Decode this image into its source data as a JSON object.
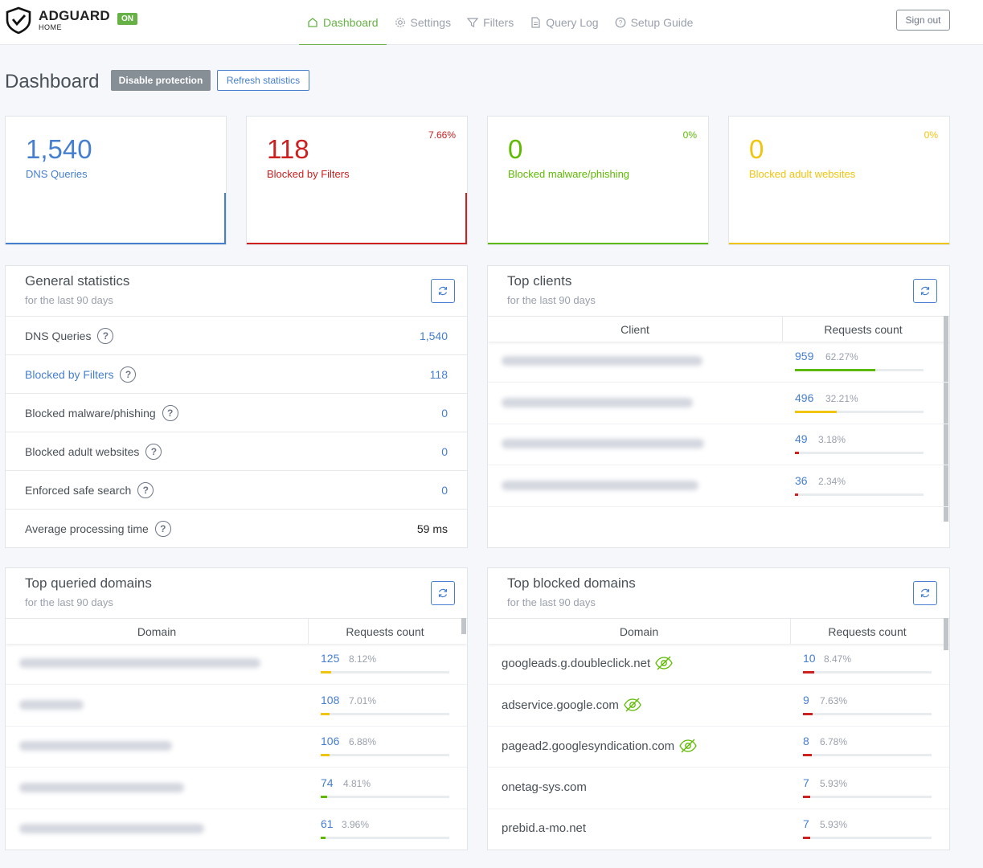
{
  "header": {
    "logo_title": "ADGUARD",
    "logo_sub": "HOME",
    "status_badge": "ON",
    "nav": [
      "Dashboard",
      "Settings",
      "Filters",
      "Query Log",
      "Setup Guide"
    ],
    "active_nav": "Dashboard",
    "signout": "Sign out"
  },
  "toolbar": {
    "title": "Dashboard",
    "disable": "Disable protection",
    "refresh": "Refresh statistics"
  },
  "stats": [
    {
      "value": "1,540",
      "label": "DNS Queries",
      "pct": "",
      "color": "#467fcf"
    },
    {
      "value": "118",
      "label": "Blocked by Filters",
      "pct": "7.66%",
      "color": "#cd201f"
    },
    {
      "value": "0",
      "label": "Blocked malware/phishing",
      "pct": "0%",
      "color": "#5eba00"
    },
    {
      "value": "0",
      "label": "Blocked adult websites",
      "pct": "0%",
      "color": "#f1c40f"
    }
  ],
  "general": {
    "title": "General statistics",
    "sub": "for the last 90 days",
    "rows": [
      {
        "label": "DNS Queries",
        "value": "1,540"
      },
      {
        "label": "Blocked by Filters",
        "value": "118"
      },
      {
        "label": "Blocked malware/phishing",
        "value": "0"
      },
      {
        "label": "Blocked adult websites",
        "value": "0"
      },
      {
        "label": "Enforced safe search",
        "value": "0"
      },
      {
        "label": "Average processing time",
        "value": "59 ms"
      }
    ]
  },
  "clients": {
    "title": "Top clients",
    "sub": "for the last 90 days",
    "col_a": "Client",
    "col_b": "Requests count",
    "rows": [
      {
        "count": "959",
        "pct": "62.27%",
        "fill": 0.6227,
        "color": "#5eba00"
      },
      {
        "count": "496",
        "pct": "32.21%",
        "fill": 0.3221,
        "color": "#f1c40f"
      },
      {
        "count": "49",
        "pct": "3.18%",
        "fill": 0.0318,
        "color": "#cd201f"
      },
      {
        "count": "36",
        "pct": "2.34%",
        "fill": 0.0234,
        "color": "#cd201f"
      }
    ]
  },
  "queried": {
    "title": "Top queried domains",
    "sub": "for the last 90 days",
    "col_a": "Domain",
    "col_b": "Requests count",
    "rows": [
      {
        "count": "125",
        "pct": "8.12%",
        "fill": 0.0812,
        "color": "#f1c40f"
      },
      {
        "count": "108",
        "pct": "7.01%",
        "fill": 0.0701,
        "color": "#f1c40f"
      },
      {
        "count": "106",
        "pct": "6.88%",
        "fill": 0.0688,
        "color": "#f1c40f"
      },
      {
        "count": "74",
        "pct": "4.81%",
        "fill": 0.0481,
        "color": "#5eba00"
      },
      {
        "count": "61",
        "pct": "3.96%",
        "fill": 0.0396,
        "color": "#5eba00"
      }
    ]
  },
  "blocked": {
    "title": "Top blocked domains",
    "sub": "for the last 90 days",
    "col_a": "Domain",
    "col_b": "Requests count",
    "rows": [
      {
        "domain": "googleads.g.doubleclick.net",
        "count": "10",
        "pct": "8.47%",
        "fill": 0.0847,
        "color": "#cd201f",
        "eye": true
      },
      {
        "domain": "adservice.google.com",
        "count": "9",
        "pct": "7.63%",
        "fill": 0.0763,
        "color": "#cd201f",
        "eye": true
      },
      {
        "domain": "pagead2.googlesyndication.com",
        "count": "8",
        "pct": "6.78%",
        "fill": 0.0678,
        "color": "#cd201f",
        "eye": true
      },
      {
        "domain": "onetag-sys.com",
        "count": "7",
        "pct": "5.93%",
        "fill": 0.0593,
        "color": "#cd201f",
        "eye": false
      },
      {
        "domain": "prebid.a-mo.net",
        "count": "7",
        "pct": "5.93%",
        "fill": 0.0593,
        "color": "#cd201f",
        "eye": false
      }
    ]
  }
}
